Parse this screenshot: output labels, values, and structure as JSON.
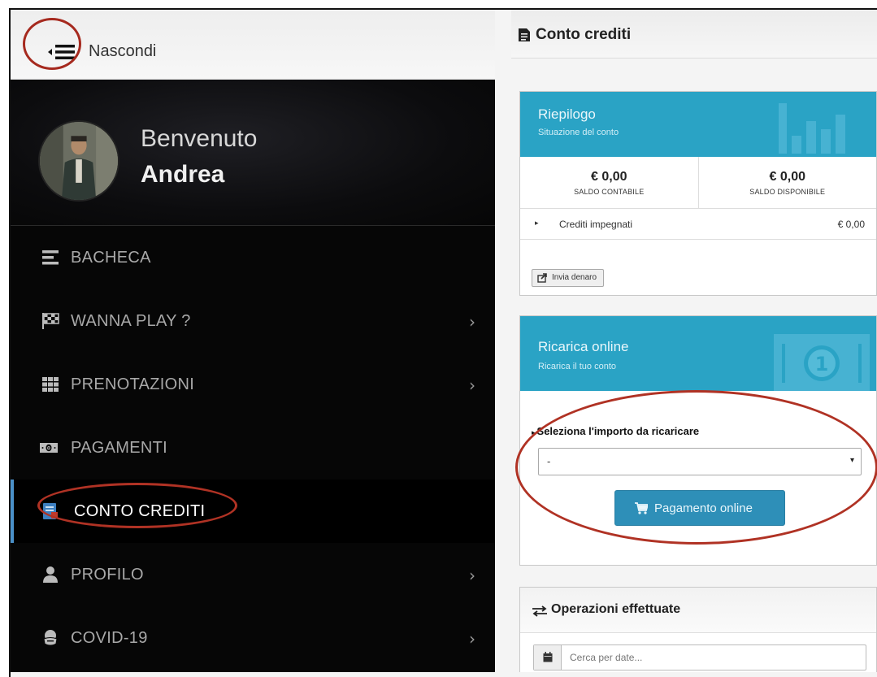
{
  "topbar": {
    "toggle_label": "Nascondi"
  },
  "profile": {
    "welcome": "Benvenuto",
    "username": "Andrea"
  },
  "menu": {
    "items": [
      {
        "label": "BACHECA",
        "icon": "list-icon",
        "chevron": ""
      },
      {
        "label": "WANNA PLAY ?",
        "icon": "checkered-flag-icon",
        "chevron": "›"
      },
      {
        "label": "PRENOTAZIONI",
        "icon": "grid-icon",
        "chevron": "›"
      },
      {
        "label": "PAGAMENTI",
        "icon": "banknote-icon",
        "chevron": ""
      },
      {
        "label": "CONTO CREDITI",
        "icon": "credit-book-icon",
        "chevron": "",
        "active": true
      },
      {
        "label": "PROFILO",
        "icon": "user-icon",
        "chevron": "›"
      },
      {
        "label": "COVID-19",
        "icon": "mask-icon",
        "chevron": "›"
      }
    ]
  },
  "page": {
    "title": "Conto crediti"
  },
  "summary": {
    "title": "Riepilogo",
    "subtitle": "Situazione del conto",
    "balance_accounting": {
      "value": "€ 0,00",
      "label": "SALDO CONTABILE"
    },
    "balance_available": {
      "value": "€ 0,00",
      "label": "SALDO DISPONIBILE"
    },
    "committed_credits": {
      "caret": "▸",
      "label": "Crediti impegnati",
      "value": "€ 0,00"
    },
    "send_money_label": "Invia denaro"
  },
  "recharge": {
    "title": "Ricarica online",
    "subtitle": "Ricarica il tuo conto",
    "select_label": "Seleziona l'importo da ricaricare",
    "select_caret": "▸",
    "select_value": "-",
    "select_arrow": "▾",
    "pay_label": "Pagamento online"
  },
  "operations": {
    "title": "Operazioni effettuate",
    "search_placeholder": "Cerca per date..."
  },
  "colors": {
    "sidebar_bg": "#060606",
    "panel_head": "#2aa3c5",
    "pay_button": "#2e8fb8",
    "active_accent": "#4a90c8",
    "annotation": "#b03224"
  }
}
